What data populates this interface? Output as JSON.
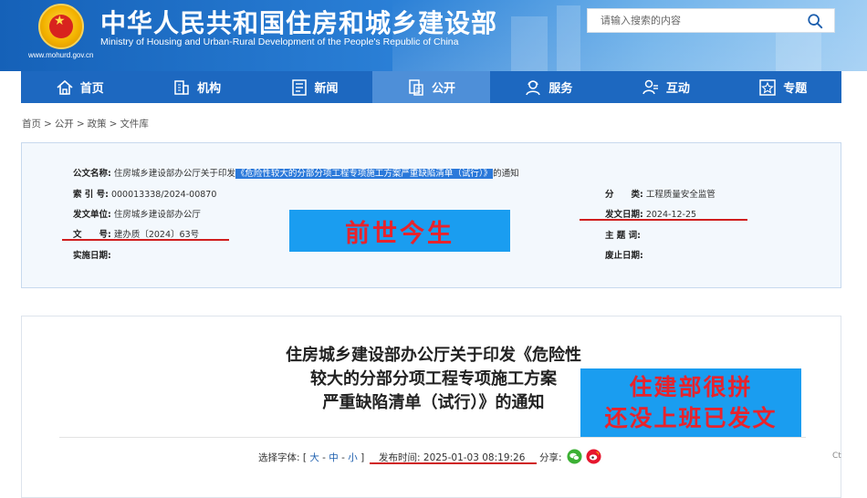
{
  "header": {
    "site_title": "中华人民共和国住房和城乡建设部",
    "site_subtitle": "Ministry of Housing and Urban-Rural Development of the People's Republic of China",
    "site_url": "www.mohurd.gov.cn",
    "search_placeholder": "请输入搜索的内容",
    "search_icon": "search-icon"
  },
  "nav": {
    "items": [
      {
        "label": "首页",
        "icon": "home-icon",
        "active": false
      },
      {
        "label": "机构",
        "icon": "building-icon",
        "active": false
      },
      {
        "label": "新闻",
        "icon": "news-icon",
        "active": false
      },
      {
        "label": "公开",
        "icon": "open-doc-icon",
        "active": true
      },
      {
        "label": "服务",
        "icon": "service-icon",
        "active": false
      },
      {
        "label": "互动",
        "icon": "interact-icon",
        "active": false
      },
      {
        "label": "专题",
        "icon": "star-icon",
        "active": false
      }
    ]
  },
  "breadcrumb": [
    "首页",
    "公开",
    "政策",
    "文件库"
  ],
  "info": {
    "doc_name_label": "公文名称:",
    "doc_name_prefix": "住房城乡建设部办公厅关于印发",
    "doc_name_highlight": "《危险性较大的分部分项工程专项施工方案严重缺陷清单（试行）》",
    "doc_name_suffix": "的通知",
    "index_label": "索 引 号:",
    "index_value": "000013338/2024-00870",
    "issuer_label": "发文单位:",
    "issuer_value": "住房城乡建设部办公厅",
    "docno_label": "文　　号:",
    "docno_value": "建办质〔2024〕63号",
    "impl_label": "实施日期:",
    "impl_value": "",
    "category_label": "分　　类:",
    "category_value": "工程质量安全监管",
    "date_label": "发文日期:",
    "date_value": "2024-12-25",
    "subject_label": "主 题 词:",
    "subject_value": "",
    "expire_label": "废止日期:",
    "expire_value": ""
  },
  "overlays": {
    "banner1": "前世今生",
    "banner2_line1": "住建部很拼",
    "banner2_line2": "还没上班已发文",
    "banner_bg": "#1a9df0",
    "banner_text_color": "#e8232c",
    "underline_color": "#d01e1e"
  },
  "article": {
    "title_line1": "住房城乡建设部办公厅关于印发《危险性",
    "title_line2": "较大的分部分项工程专项施工方案",
    "title_line3": "严重缺陷清单（试行）》的通知",
    "font_select_label": "选择字体:",
    "font_large": "大",
    "font_medium": "中",
    "font_small": "小",
    "publish_time_label": "发布时间:",
    "publish_time_value": "2025-01-03 08:19:26",
    "share_label": "分享:",
    "edge_text": "Ct"
  },
  "colors": {
    "header_blue": "#1561b8",
    "nav_blue": "#1d68c0",
    "nav_active": "#4e8fd8",
    "highlight": "#2b79da"
  }
}
